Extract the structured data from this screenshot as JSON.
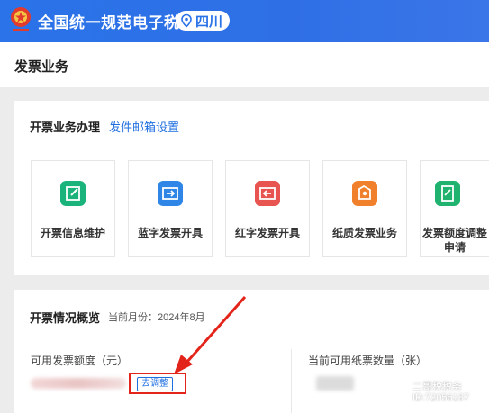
{
  "header": {
    "site_title": "全国统一规范电子税务局",
    "region": "四川",
    "colors": {
      "brand_blue": "#2a73e8"
    }
  },
  "page": {
    "title": "发票业务"
  },
  "invoice_ops": {
    "title": "开票业务办理",
    "mail_link": "发件邮箱设置",
    "tiles": [
      {
        "label": "开票信息维护",
        "icon": "edit-icon",
        "color": "#19b37b"
      },
      {
        "label": "蓝字发票开具",
        "icon": "blue-invoice-icon",
        "color": "#2f86e6"
      },
      {
        "label": "红字发票开具",
        "icon": "red-invoice-icon",
        "color": "#e85450"
      },
      {
        "label": "纸质发票业务",
        "icon": "paper-invoice-icon",
        "color": "#f0802b"
      },
      {
        "label_line1": "发票额度调整",
        "label_line2": "申请",
        "icon": "quota-apply-icon",
        "color": "#1fb36f"
      }
    ]
  },
  "overview": {
    "title": "开票情况概览",
    "month_label": "当前月份：2024年8月",
    "quota_label": "可用发票额度（元）",
    "adjust_button": "去调整",
    "paper_label": "当前可用纸票数量（张）"
  },
  "watermark": {
    "line1": "二哥税税务",
    "line2": "ID:72056187"
  }
}
